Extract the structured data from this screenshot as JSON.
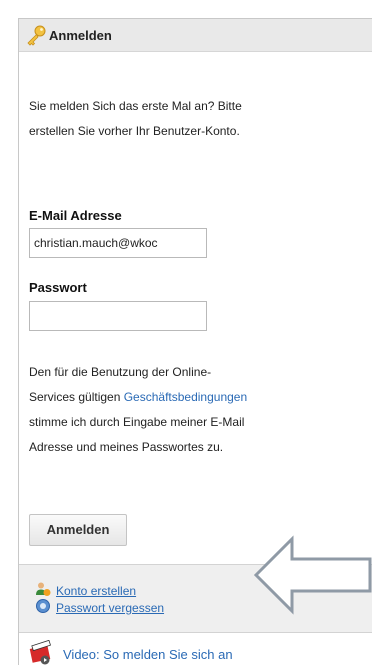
{
  "header": {
    "title": "Anmelden",
    "icon": "key-icon"
  },
  "intro": {
    "line1": "Sie melden Sich das erste Mal an? Bitte",
    "line2": "erstellen Sie vorher Ihr Benutzer-Konto."
  },
  "email": {
    "label": "E-Mail Adresse",
    "value": "christian.mauch@wkoc"
  },
  "password": {
    "label": "Passwort",
    "value": ""
  },
  "terms": {
    "line1": "Den für die Benutzung der Online-",
    "line2_prefix": "Services gültigen ",
    "line2_link": "Geschäftsbedingungen",
    "line3": "stimme ich durch Eingabe meiner E-Mail",
    "line4": "Adresse und meines Passwortes zu."
  },
  "login_button": {
    "label": "Anmelden"
  },
  "links": {
    "create_account": "Konto erstellen",
    "forgot_password": "Passwort vergessen"
  },
  "video": {
    "label": "Video: So melden Sie sich an"
  },
  "colors": {
    "link": "#2a6ab5",
    "header_bg": "#e9e9e9",
    "linkbox_bg": "#efefef"
  }
}
